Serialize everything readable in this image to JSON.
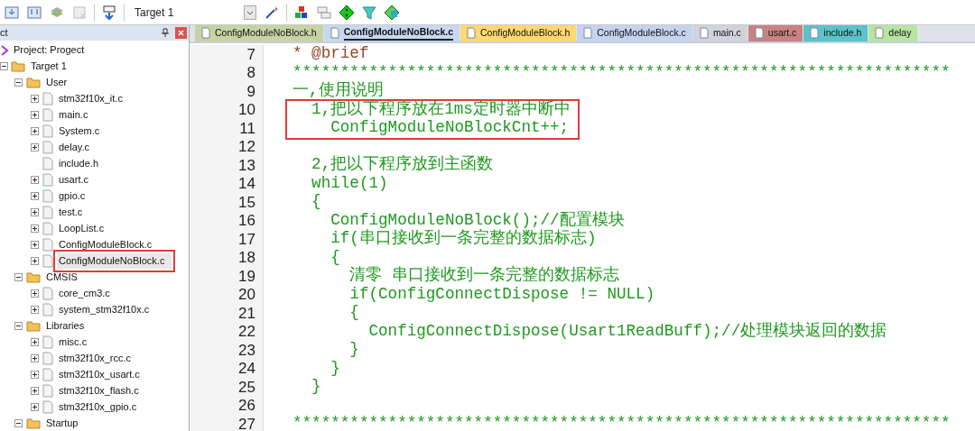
{
  "toolbar": {
    "target": "Target 1"
  },
  "project_panel": {
    "title": "ct",
    "tree": [
      {
        "label": "Project: Progect",
        "kind": "project",
        "expanded": true,
        "children": [
          {
            "label": "Target 1",
            "kind": "target",
            "expanded": true,
            "children": [
              {
                "label": "User",
                "kind": "folder",
                "expanded": true,
                "children": [
                  {
                    "label": "stm32f10x_it.c",
                    "kind": "file",
                    "expandable": true,
                    "selected": false,
                    "annotated": false
                  },
                  {
                    "label": "main.c",
                    "kind": "file",
                    "expandable": true,
                    "selected": false,
                    "annotated": false
                  },
                  {
                    "label": "System.c",
                    "kind": "file",
                    "expandable": true,
                    "selected": false,
                    "annotated": false
                  },
                  {
                    "label": "delay.c",
                    "kind": "file",
                    "expandable": true,
                    "selected": false,
                    "annotated": false
                  },
                  {
                    "label": "include.h",
                    "kind": "file",
                    "expandable": false,
                    "selected": false,
                    "annotated": false
                  },
                  {
                    "label": "usart.c",
                    "kind": "file",
                    "expandable": true,
                    "selected": false,
                    "annotated": false
                  },
                  {
                    "label": "gpio.c",
                    "kind": "file",
                    "expandable": true,
                    "selected": false,
                    "annotated": false
                  },
                  {
                    "label": "test.c",
                    "kind": "file",
                    "expandable": true,
                    "selected": false,
                    "annotated": false
                  },
                  {
                    "label": "LoopList.c",
                    "kind": "file",
                    "expandable": true,
                    "selected": false,
                    "annotated": false
                  },
                  {
                    "label": "ConfigModuleBlock.c",
                    "kind": "file",
                    "expandable": true,
                    "selected": false,
                    "annotated": false
                  },
                  {
                    "label": "ConfigModuleNoBlock.c",
                    "kind": "file",
                    "expandable": true,
                    "selected": true,
                    "annotated": true
                  }
                ]
              },
              {
                "label": "CMSIS",
                "kind": "folder",
                "expanded": true,
                "children": [
                  {
                    "label": "core_cm3.c",
                    "kind": "file",
                    "expandable": true,
                    "selected": false,
                    "annotated": false
                  },
                  {
                    "label": "system_stm32f10x.c",
                    "kind": "file",
                    "expandable": true,
                    "selected": false,
                    "annotated": false
                  }
                ]
              },
              {
                "label": "Libraries",
                "kind": "folder",
                "expanded": true,
                "children": [
                  {
                    "label": "misc.c",
                    "kind": "file",
                    "expandable": true,
                    "selected": false,
                    "annotated": false
                  },
                  {
                    "label": "stm32f10x_rcc.c",
                    "kind": "file",
                    "expandable": true,
                    "selected": false,
                    "annotated": false
                  },
                  {
                    "label": "stm32f10x_usart.c",
                    "kind": "file",
                    "expandable": true,
                    "selected": false,
                    "annotated": false
                  },
                  {
                    "label": "stm32f10x_flash.c",
                    "kind": "file",
                    "expandable": true,
                    "selected": false,
                    "annotated": false
                  },
                  {
                    "label": "stm32f10x_gpio.c",
                    "kind": "file",
                    "expandable": true,
                    "selected": false,
                    "annotated": false
                  }
                ]
              },
              {
                "label": "Startup",
                "kind": "folder",
                "expanded": true
              }
            ]
          }
        ]
      }
    ]
  },
  "tabs": [
    {
      "label": "ConfigModuleNoBlock.h",
      "selected": false,
      "color": "#c8d3a5"
    },
    {
      "label": "ConfigModuleNoBlock.c",
      "selected": true,
      "color": "#c8d8f0"
    },
    {
      "label": "ConfigModuleBlock.h",
      "selected": false,
      "color": "#ffd872"
    },
    {
      "label": "ConfigModuleBlock.c",
      "selected": false,
      "color": "#c6d3ee"
    },
    {
      "label": "main.c",
      "selected": false,
      "color": "#d2d2da"
    },
    {
      "label": "usart.c",
      "selected": false,
      "color": "#c88282"
    },
    {
      "label": "include.h",
      "selected": false,
      "color": "#5cc3cb"
    },
    {
      "label": "delay",
      "selected": false,
      "color": "#b8e4a2"
    }
  ],
  "code": [
    {
      "number": "7",
      "text": "* @brief",
      "kind": "doc",
      "annotated": false
    },
    {
      "number": "8",
      "text": "*********************************************************************",
      "kind": "comment",
      "annotated": false
    },
    {
      "number": "9",
      "text": "一,使用说明",
      "kind": "comment",
      "annotated": false
    },
    {
      "number": "10",
      "text": "  1,把以下程序放在1ms定时器中断中",
      "kind": "comment",
      "annotated": true
    },
    {
      "number": "11",
      "text": "    ConfigModuleNoBlockCnt++;",
      "kind": "comment",
      "annotated": true
    },
    {
      "number": "12",
      "annotated": false
    },
    {
      "number": "13",
      "text": "  2,把以下程序放到主函数",
      "kind": "comment",
      "annotated": false
    },
    {
      "number": "14",
      "text": "  while(1)",
      "kind": "comment",
      "annotated": false
    },
    {
      "number": "15",
      "text": "  {",
      "kind": "comment",
      "annotated": false
    },
    {
      "number": "16",
      "text": "    ConfigModuleNoBlock();//配置模块",
      "kind": "comment",
      "annotated": false
    },
    {
      "number": "17",
      "text": "    if(串口接收到一条完整的数据标志)",
      "kind": "comment",
      "annotated": false
    },
    {
      "number": "18",
      "text": "    {",
      "kind": "comment",
      "annotated": false
    },
    {
      "number": "19",
      "text": "      清零 串口接收到一条完整的数据标志",
      "kind": "comment",
      "annotated": false
    },
    {
      "number": "20",
      "text": "      if(ConfigConnectDispose != NULL)",
      "kind": "comment",
      "annotated": false
    },
    {
      "number": "21",
      "text": "      {",
      "kind": "comment",
      "annotated": false
    },
    {
      "number": "22",
      "text": "        ConfigConnectDispose(Usart1ReadBuff);//处理模块返回的数据",
      "kind": "comment",
      "annotated": false
    },
    {
      "number": "23",
      "text": "      }",
      "kind": "comment",
      "annotated": false
    },
    {
      "number": "24",
      "text": "    }",
      "kind": "comment",
      "annotated": false
    },
    {
      "number": "25",
      "text": "  }",
      "kind": "comment",
      "annotated": false
    },
    {
      "number": "26",
      "annotated": false
    },
    {
      "number": "27",
      "text": "*********************************************************************",
      "kind": "comment",
      "annotated": false
    }
  ]
}
